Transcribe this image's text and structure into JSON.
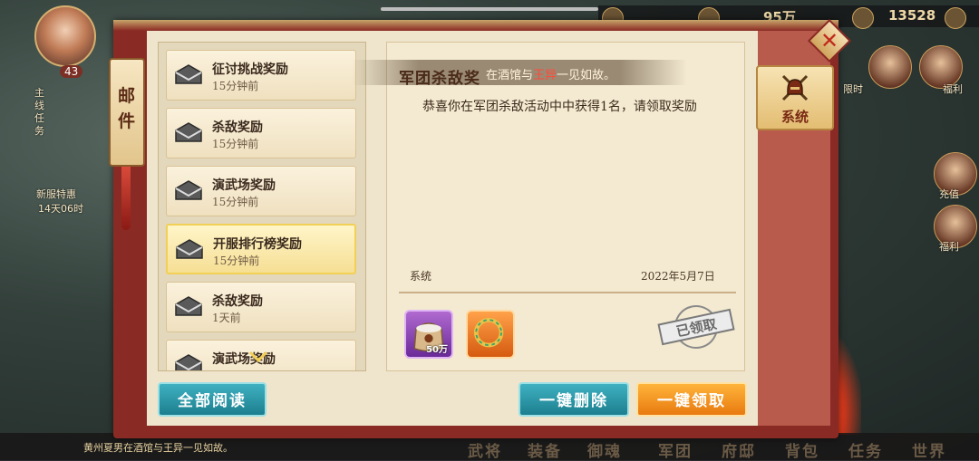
{
  "background": {
    "hero_level": "43",
    "resource_1": "95万",
    "resource_2": "13528",
    "side_items": [
      "主线任务",
      "新服特惠",
      "14天06时"
    ],
    "right_labels": [
      "限时",
      "福利",
      "充值",
      "福利"
    ],
    "chat_line": "黄州夏男在酒馆与王异一见如故。",
    "bottom_nav": [
      "武将",
      "装备",
      "御魂",
      "军团",
      "府邸",
      "背包",
      "任务",
      "世界"
    ]
  },
  "panel": {
    "tab_label": "邮件",
    "category_tab": "系统",
    "mail_list": [
      {
        "title": "征讨挑战奖励",
        "time": "15分钟前",
        "selected": false
      },
      {
        "title": "杀敌奖励",
        "time": "15分钟前",
        "selected": false
      },
      {
        "title": "演武场奖励",
        "time": "15分钟前",
        "selected": false
      },
      {
        "title": "开服排行榜奖励",
        "time": "15分钟前",
        "selected": true
      },
      {
        "title": "杀敌奖励",
        "time": "1天前",
        "selected": false
      },
      {
        "title": "演武场奖励",
        "time": "",
        "selected": false
      }
    ],
    "detail": {
      "title": "军团杀敌奖",
      "body": "恭喜你在军团杀敌活动中中获得1名，请领取奖励",
      "sender": "系统",
      "date": "2022年5月7日",
      "rewards": [
        {
          "icon": "rice-sack-icon",
          "qty": "50万"
        },
        {
          "icon": "jade-ring-icon",
          "qty": ""
        }
      ],
      "stamp": "已领取"
    },
    "scroll_notice": {
      "prefix": "在酒馆与",
      "name": "王异",
      "suffix": "一见如故。"
    },
    "buttons": {
      "read_all": "全部阅读",
      "delete_all": "一键删除",
      "claim_all": "一键领取"
    }
  },
  "colors": {
    "frame_red": "#8a2a24",
    "parchment": "#efe5cd",
    "teal_button": "#1d7f8f",
    "orange_button": "#e87a10",
    "selected_border": "#f2cf55"
  }
}
